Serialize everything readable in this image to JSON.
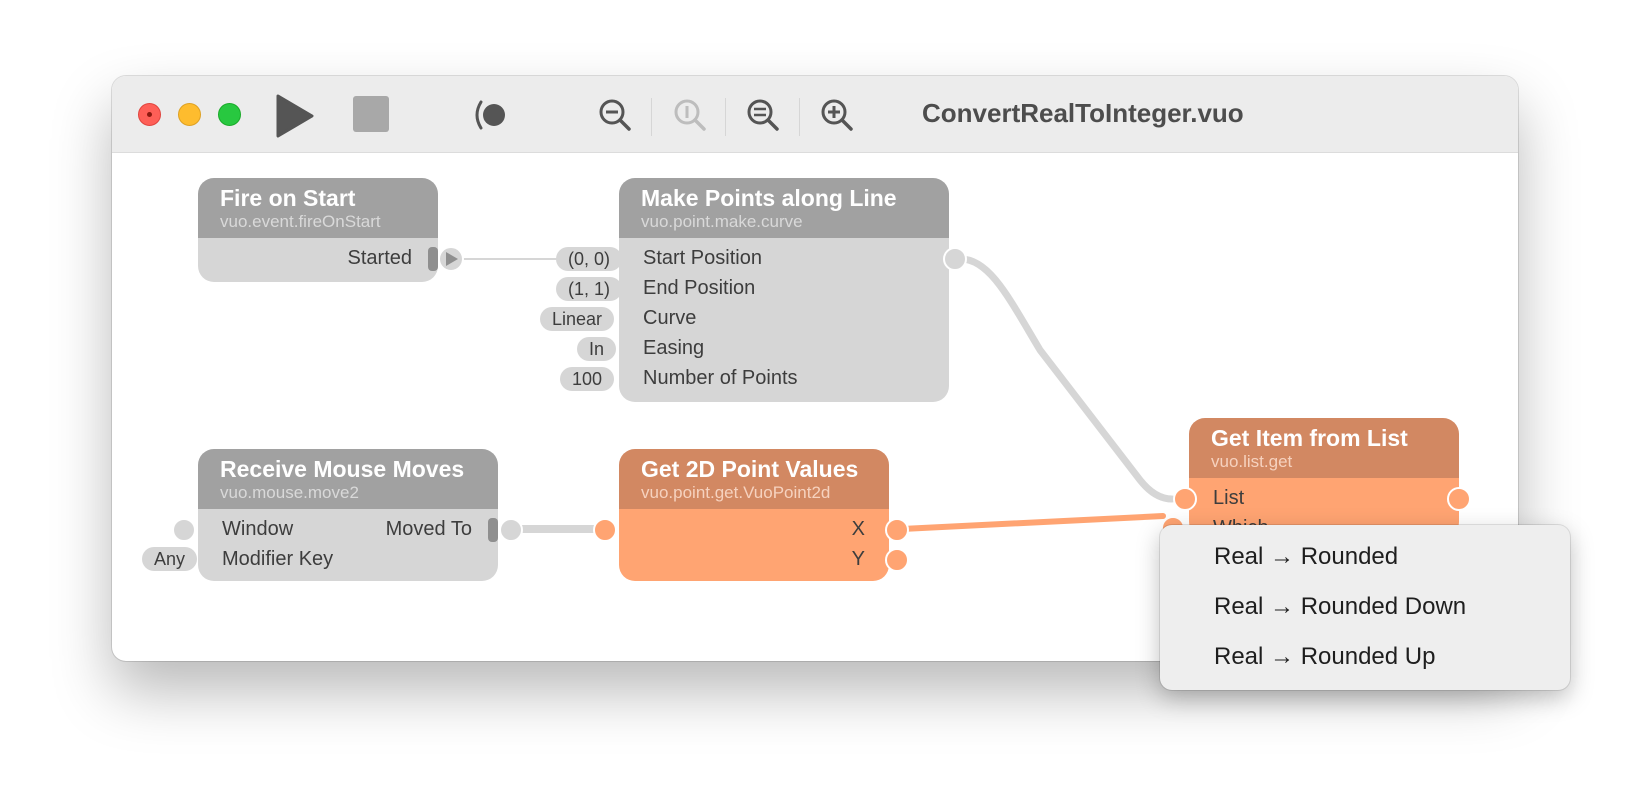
{
  "window": {
    "title": "ConvertRealToInteger.vuo",
    "toolbar": {
      "run": "play-icon",
      "stop": "stop-icon",
      "show_events": "show-events-icon",
      "zoom_out": "zoom-out-icon",
      "zoom_actual": "zoom-actual-size-icon",
      "zoom_to_fit": "zoom-to-fit-icon",
      "zoom_in": "zoom-in-icon"
    }
  },
  "colors": {
    "gray_header": "#a1a1a1",
    "gray_body": "#d6d6d6",
    "orange_header": "#d28862",
    "orange_body": "#ffa472"
  },
  "nodes": {
    "fire_on_start": {
      "title": "Fire on Start",
      "class": "vuo.event.fireOnStart",
      "outputs": [
        "Started"
      ]
    },
    "make_points": {
      "title": "Make Points along Line",
      "class": "vuo.point.make.curve",
      "inputs": [
        {
          "label": "Start Position",
          "value": "(0, 0)"
        },
        {
          "label": "End Position",
          "value": "(1, 1)"
        },
        {
          "label": "Curve",
          "value": "Linear"
        },
        {
          "label": "Easing",
          "value": "In"
        },
        {
          "label": "Number of Points",
          "value": "100"
        }
      ]
    },
    "receive_mouse": {
      "title": "Receive Mouse Moves",
      "class": "vuo.mouse.move2",
      "inputs": [
        {
          "label": "Window",
          "value": ""
        },
        {
          "label": "Modifier Key",
          "value": "Any"
        }
      ],
      "outputs": [
        "Moved To"
      ]
    },
    "get_point_values": {
      "title": "Get 2D Point Values",
      "class": "vuo.point.get.VuoPoint2d",
      "outputs": [
        "X",
        "Y"
      ]
    },
    "get_item": {
      "title": "Get Item from List",
      "class": "vuo.list.get",
      "inputs": [
        {
          "label": "List"
        },
        {
          "label": "Which"
        }
      ]
    }
  },
  "context_menu": {
    "items": [
      "Real → Rounded",
      "Real → Rounded Down",
      "Real → Rounded Up"
    ]
  }
}
